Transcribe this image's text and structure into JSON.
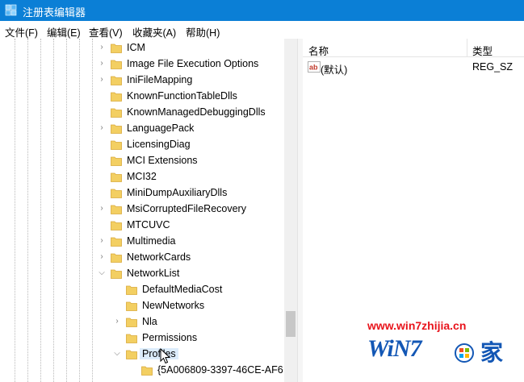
{
  "window": {
    "title": "注册表编辑器",
    "icon": "regedit-icon"
  },
  "menu": [
    "文件(F)",
    "编辑(E)",
    "查看(V)",
    "收藏夹(A)",
    "帮助(H)"
  ],
  "tree": {
    "items": [
      {
        "label": "ICM",
        "expander": "collapsed",
        "level": 1
      },
      {
        "label": "Image File Execution Options",
        "expander": "collapsed",
        "level": 1
      },
      {
        "label": "IniFileMapping",
        "expander": "collapsed",
        "level": 1
      },
      {
        "label": "KnownFunctionTableDlls",
        "expander": "none",
        "level": 1
      },
      {
        "label": "KnownManagedDebuggingDlls",
        "expander": "none",
        "level": 1
      },
      {
        "label": "LanguagePack",
        "expander": "collapsed",
        "level": 1
      },
      {
        "label": "LicensingDiag",
        "expander": "none",
        "level": 1
      },
      {
        "label": "MCI Extensions",
        "expander": "none",
        "level": 1
      },
      {
        "label": "MCI32",
        "expander": "none",
        "level": 1
      },
      {
        "label": "MiniDumpAuxiliaryDlls",
        "expander": "none",
        "level": 1
      },
      {
        "label": "MsiCorruptedFileRecovery",
        "expander": "collapsed",
        "level": 1
      },
      {
        "label": "MTCUVC",
        "expander": "none",
        "level": 1
      },
      {
        "label": "Multimedia",
        "expander": "collapsed",
        "level": 1
      },
      {
        "label": "NetworkCards",
        "expander": "collapsed",
        "level": 1
      },
      {
        "label": "NetworkList",
        "expander": "expanded",
        "level": 1
      },
      {
        "label": "DefaultMediaCost",
        "expander": "none",
        "level": 2
      },
      {
        "label": "NewNetworks",
        "expander": "none",
        "level": 2
      },
      {
        "label": "Nla",
        "expander": "collapsed",
        "level": 2
      },
      {
        "label": "Permissions",
        "expander": "none",
        "level": 2
      },
      {
        "label": "Profiles",
        "expander": "expanded",
        "level": 2,
        "selected": true
      },
      {
        "label": "{5A006809-3397-46CE-AF6",
        "expander": "none",
        "level": 3
      }
    ]
  },
  "values_pane": {
    "col_name": "名称",
    "col_type": "类型",
    "rows": [
      {
        "icon": "string-value-icon",
        "name": "(默认)",
        "type": "REG_SZ"
      }
    ]
  },
  "watermark": {
    "url": "www.win7zhijia.cn",
    "brand": "WiN7",
    "home": "家"
  },
  "colors": {
    "titlebar": "#0b7fd6",
    "folder": "#f3cf62",
    "selection": "#dcecfb",
    "watermark_red": "#e8141c",
    "watermark_blue": "#1357b5"
  }
}
